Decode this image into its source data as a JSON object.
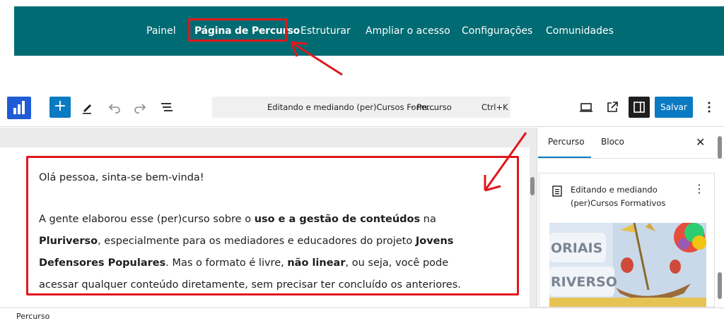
{
  "topnav": {
    "items": [
      {
        "label": "Painel",
        "active": false
      },
      {
        "label": "Página de Percurso",
        "active": true
      },
      {
        "label": "Estruturar",
        "active": false
      },
      {
        "label": "Ampliar o acesso",
        "active": false
      },
      {
        "label": "Configurações",
        "active": false
      },
      {
        "label": "Comunidades",
        "active": false
      }
    ]
  },
  "toolbar": {
    "add_label": "+",
    "command_title": "Editando e mediando (per)Cursos Form...",
    "command_subtitle": "· Percurso",
    "command_shortcut": "Ctrl+K",
    "save_label": "Salvar",
    "icons": [
      "site-logo-icon",
      "add-block-icon",
      "pen-tool-icon",
      "undo-icon",
      "redo-icon",
      "document-overview-icon",
      "view-desktop-icon",
      "external-link-icon",
      "sidebar-toggle-icon",
      "more-options-icon"
    ]
  },
  "content": {
    "greeting": "Olá pessoa, sinta-se bem-vinda!",
    "para1": [
      {
        "text": "A gente elaborou esse (per)curso sobre o ",
        "bold": false
      },
      {
        "text": "uso e a gestão de conteúdos",
        "bold": true
      },
      {
        "text": " na",
        "bold": false
      }
    ],
    "para2": [
      {
        "text": "Pluriverso",
        "bold": true
      },
      {
        "text": ", especialmente para os mediadores e educadores do projeto ",
        "bold": false
      },
      {
        "text": "Jovens",
        "bold": true
      }
    ],
    "para3": [
      {
        "text": "Defensores Populares",
        "bold": true
      },
      {
        "text": ". Mas o formato é livre, ",
        "bold": false
      },
      {
        "text": "não linear",
        "bold": true
      },
      {
        "text": ", ou seja, você pode",
        "bold": false
      }
    ],
    "para4": [
      {
        "text": "acessar qualquer conteúdo diretamente, sem precisar ter concluído os anteriores.",
        "bold": false
      }
    ]
  },
  "sidebar": {
    "tabs": [
      {
        "label": "Percurso",
        "active": true
      },
      {
        "label": "Bloco",
        "active": false
      }
    ],
    "close_label": "✕",
    "card_title": "Editando e mediando (per)Cursos Formativos",
    "kebab_label": "⋮",
    "image_text_1": "ORIAIS",
    "image_text_2": "RIVERSO"
  },
  "footer": {
    "breadcrumb": "Percurso"
  },
  "colors": {
    "nav_bg": "#006b72",
    "accent": "#0a7ac2",
    "annotation_red": "#e0171c"
  }
}
